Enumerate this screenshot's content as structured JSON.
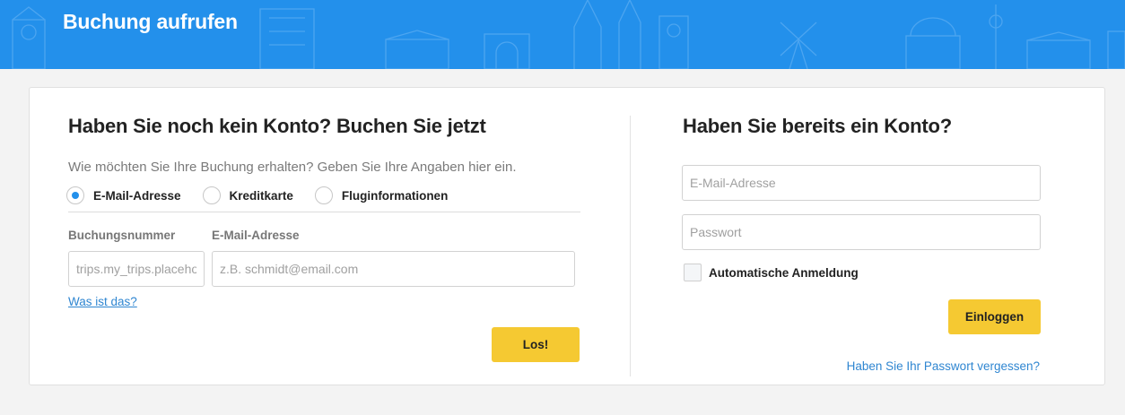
{
  "header": {
    "title": "Buchung aufrufen",
    "bg_color": "#2390eb"
  },
  "left": {
    "title": "Haben Sie noch kein Konto? Buchen Sie jetzt",
    "subtitle": "Wie möchten Sie Ihre Buchung erhalten? Geben Sie Ihre Angaben hier ein.",
    "options": [
      {
        "label": "E-Mail-Adresse",
        "checked": true
      },
      {
        "label": "Kreditkarte",
        "checked": false
      },
      {
        "label": "Fluginformationen",
        "checked": false
      }
    ],
    "booking_label": "Buchungsnummer",
    "booking_placeholder": "trips.my_trips.placeholder",
    "email_label": "E-Mail-Adresse",
    "email_placeholder": "z.B. schmidt@email.com",
    "help_link": "Was ist das?",
    "submit_label": "Los!"
  },
  "right": {
    "title": "Haben Sie bereits ein Konto?",
    "email_placeholder": "E-Mail-Adresse",
    "password_placeholder": "Passwort",
    "auto_login_label": "Automatische Anmeldung",
    "login_label": "Einloggen",
    "forgot_link": "Haben Sie Ihr Passwort vergessen?"
  },
  "colors": {
    "accent": "#2390eb",
    "button": "#f5c932",
    "link": "#2f86d1"
  }
}
